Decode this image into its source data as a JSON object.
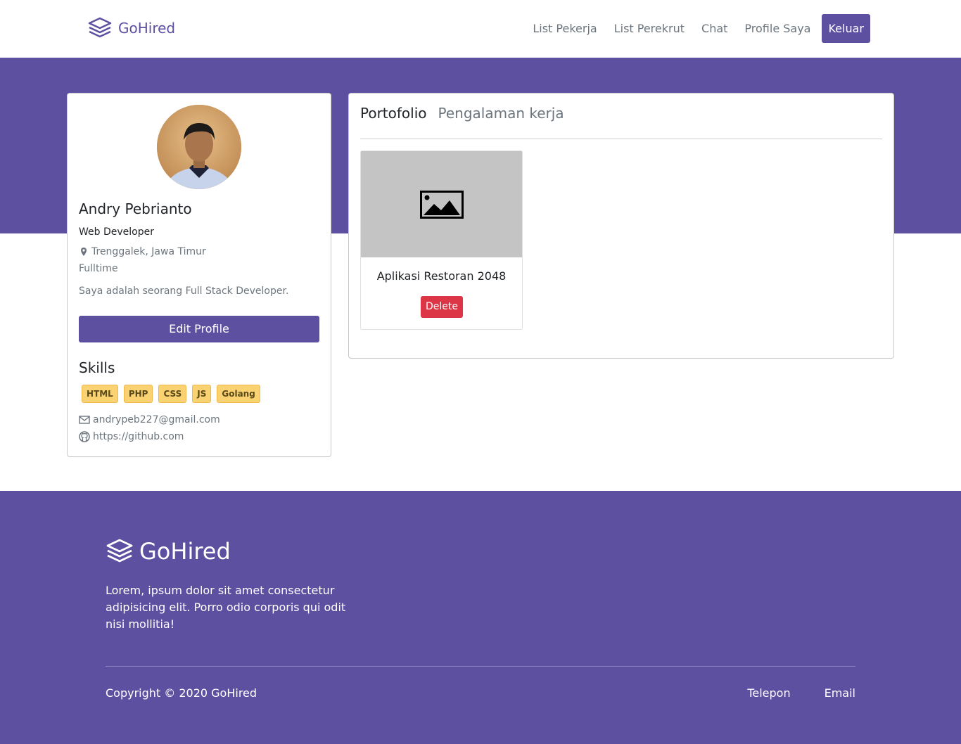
{
  "navbar": {
    "brand": "GoHired",
    "links": [
      "List Pekerja",
      "List Perekrut",
      "Chat",
      "Profile Saya"
    ],
    "logout": "Keluar"
  },
  "profile": {
    "name": "Andry Pebrianto",
    "title": "Web Developer",
    "location": "Trenggalek, Jawa Timur",
    "job_type": "Fulltime",
    "bio": "Saya adalah seorang Full Stack Developer.",
    "edit_label": "Edit Profile",
    "skills_title": "Skills",
    "skills": [
      "HTML",
      "PHP",
      "CSS",
      "JS",
      "Golang"
    ],
    "email": "andrypeb227@gmail.com",
    "github": "https://github.com"
  },
  "portfolio": {
    "tabs": [
      "Portofolio",
      "Pengalaman kerja"
    ],
    "items": [
      {
        "title": "Aplikasi Restoran 2048",
        "delete_label": "Delete"
      }
    ]
  },
  "footer": {
    "brand": "GoHired",
    "description": "Lorem, ipsum dolor sit amet consectetur adipisicing elit. Porro odio corporis qui odit nisi mollitia!",
    "copyright": "Copyright © 2020 GoHired",
    "links": [
      "Telepon",
      "Email"
    ]
  },
  "colors": {
    "primary": "#5e50a1",
    "danger": "#dc3545",
    "skill": "#fbd271"
  }
}
